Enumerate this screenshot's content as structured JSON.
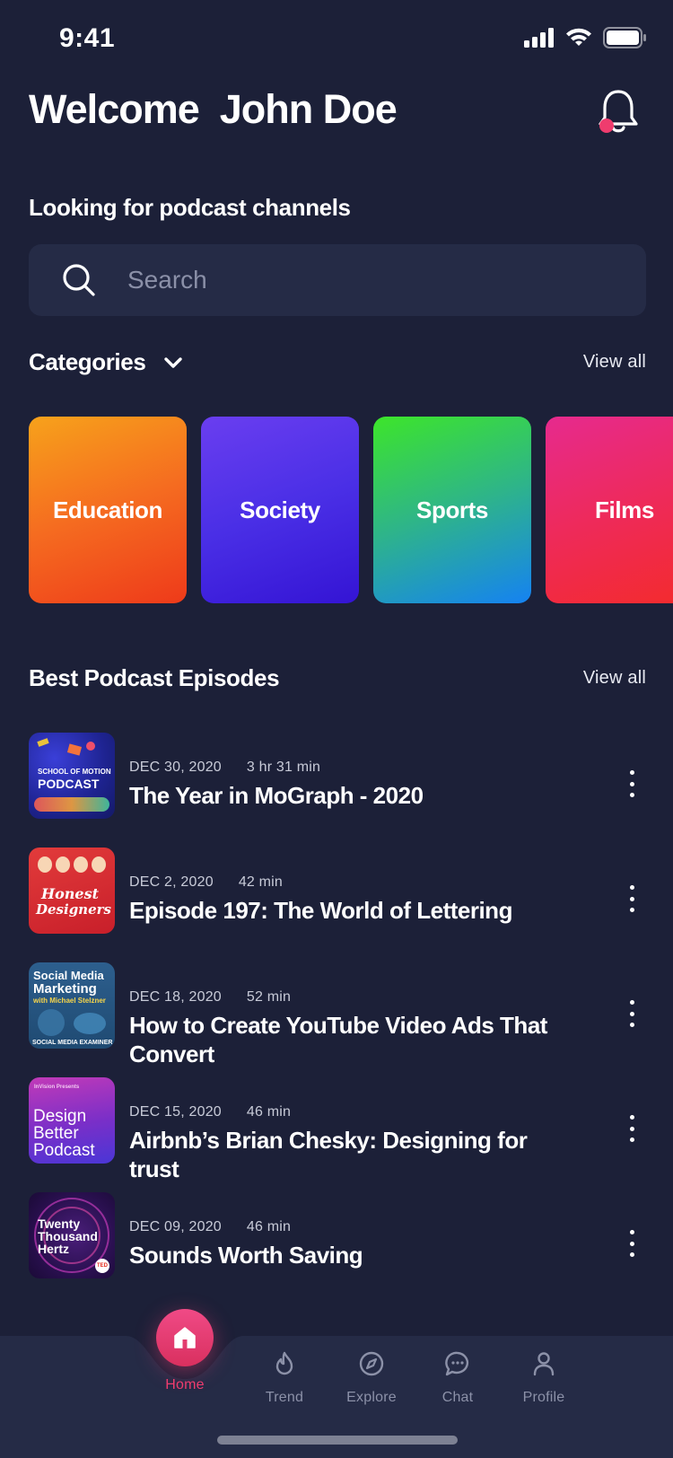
{
  "status_bar": {
    "time": "9:41"
  },
  "header": {
    "welcome": "Welcome  John Doe"
  },
  "subtitle": "Looking for podcast channels",
  "search": {
    "placeholder": "Search",
    "value": ""
  },
  "categories": {
    "title": "Categories",
    "view_all": "View all",
    "items": [
      {
        "label": "Education"
      },
      {
        "label": "Society"
      },
      {
        "label": "Sports"
      },
      {
        "label": "Films"
      }
    ]
  },
  "episodes": {
    "title": "Best Podcast Episodes",
    "view_all": "View all",
    "items": [
      {
        "date": "DEC 30, 2020",
        "duration": "3 hr 31 min",
        "title": "The Year in MoGraph - 2020",
        "thumb_text": "SCHOOL OF MOTION PODCAST"
      },
      {
        "date": "DEC 2, 2020",
        "duration": "42 min",
        "title": "Episode 197: The World of Lettering",
        "thumb_text": "Honest Designers"
      },
      {
        "date": "DEC 18, 2020",
        "duration": "52 min",
        "title": "How to Create YouTube Video Ads That Convert",
        "thumb_text": "Social Media Marketing"
      },
      {
        "date": "DEC 15, 2020",
        "duration": "46 min",
        "title": "Airbnb’s Brian Chesky: Designing for trust",
        "thumb_text": "Design Better Podcast"
      },
      {
        "date": "DEC 09, 2020",
        "duration": "46 min",
        "title": "Sounds Worth Saving",
        "thumb_text": "Twenty Thousand Hertz"
      }
    ]
  },
  "tab_bar": {
    "items": [
      {
        "label": "Home",
        "icon": "home-icon",
        "active": true
      },
      {
        "label": "Trend",
        "icon": "flame-icon"
      },
      {
        "label": "Explore",
        "icon": "compass-icon"
      },
      {
        "label": "Chat",
        "icon": "chat-icon"
      },
      {
        "label": "Profile",
        "icon": "profile-icon"
      }
    ]
  },
  "colors": {
    "background": "#1c2038",
    "accent": "#ef3c6e",
    "search_bg": "#252b46"
  }
}
